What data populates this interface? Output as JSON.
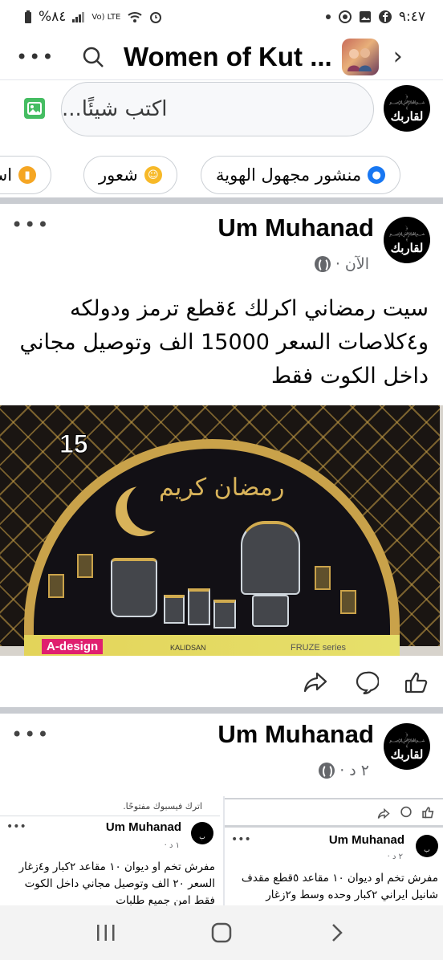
{
  "status_bar": {
    "battery": "%٨٤",
    "network": "Vo) LTE",
    "time": "٩:٤٧"
  },
  "header": {
    "title": "Women of Kut ...",
    "more_icon": "more-dots-icon",
    "search_icon": "search-icon",
    "chevron_icon": "chevron-right-icon"
  },
  "composer": {
    "placeholder": "اكتب شيئًا...",
    "photo_icon": "photo-icon",
    "avatar_word": "لقاربك"
  },
  "chips": [
    {
      "label": "منشور مجهول الهوية",
      "icon": "anonymous-icon",
      "color": "#1877f2"
    },
    {
      "label": "شعور",
      "icon": "emoji-icon",
      "color": "#f7b928"
    },
    {
      "label": "استطلاع",
      "icon": "poll-icon",
      "color": "#f5a623"
    }
  ],
  "post1": {
    "author": "Um Muhanad",
    "time": "الآن ·",
    "text": "سيت رمضاني اكرلك ٤قطع ترمز ودولكه و٤كلاصات السعر 15000 الف وتوصيل مجاني داخل الكوت فقط",
    "image": {
      "badge": "15",
      "ramadan_text": "رمضان كريم",
      "brand1": "A-design",
      "brand2": "KALIDSAN",
      "brand3": "FRUZE series"
    }
  },
  "actions": {
    "share_icon": "share-icon",
    "comment_icon": "comment-icon",
    "like_icon": "like-icon"
  },
  "post2": {
    "author": "Um Muhanad",
    "time": "٢ د ·",
    "left_card": {
      "header_text": "اترك فيسبوك مفتوحًا.",
      "author": "Um Muhanad",
      "time": "١ د ·",
      "text": "مفرش تخم او ديوان ١٠ مقاعد ٢كبار و٤زغار السعر ٢٠ الف وتوصيل مجاني داخل الكوت فقط امن جميع طلبات"
    },
    "right_card": {
      "author": "Um Muhanad",
      "time": "٢ د ·",
      "text": "مفرش تخم او ديوان ١٠ مقاعد ٥قطع مقدف شانيل ايراني ٢كبار وحده وسط و٢زغار"
    }
  },
  "navbar": {
    "recents": "recents-icon",
    "home": "home-icon",
    "back": "back-icon"
  }
}
